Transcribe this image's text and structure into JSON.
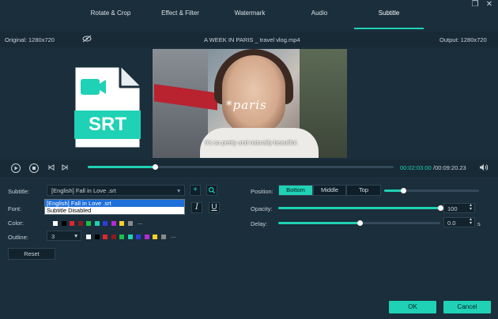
{
  "tabs": [
    {
      "label": "Rotate & Crop"
    },
    {
      "label": "Effect & Filter"
    },
    {
      "label": "Watermark"
    },
    {
      "label": "Audio"
    },
    {
      "label": "Subtitle"
    }
  ],
  "info": {
    "original": "Original: 1280x720",
    "filename": "A WEEK IN PARIS _ travel vlog.mp4",
    "output": "Output: 1280x720"
  },
  "preview": {
    "overlay_text": "*paris",
    "subtitle_text": "It's so pretty and naturally beautiful.",
    "srt_label": "SRT"
  },
  "playback": {
    "current_time": "00:02:03.00",
    "total_time": "/00:09:20.23",
    "progress": 0.22
  },
  "subtitle_settings": {
    "subtitle_label": "Subtitle:",
    "subtitle_value": "[English] Fall in Love .srt",
    "dropdown_options": [
      "[English] Fall in Love .srt",
      "Subtitle Disabled"
    ],
    "font_label": "Font:",
    "italic_label": "I",
    "underline_label": "U",
    "color_label": "Color:",
    "outline_label": "Outline:",
    "outline_value": "3",
    "more_label": "...",
    "reset_label": "Reset",
    "colors": [
      "#ffffff",
      "#000000",
      "#e0262c",
      "#8b1a1a",
      "#1fbf4d",
      "#1fd1b5",
      "#2a3fd8",
      "#b52ad8",
      "#f0d22a",
      "#8a8a8a"
    ]
  },
  "position_settings": {
    "position_label": "Position:",
    "options": [
      "Bottom",
      "Middle",
      "Top"
    ],
    "selected": "Bottom",
    "position_level": 0.2,
    "opacity_label": "Opacity:",
    "opacity_value": "100",
    "opacity_level": 1.0,
    "delay_label": "Delay:",
    "delay_value": "0.0",
    "delay_unit": "s",
    "delay_level": 0.5
  },
  "footer": {
    "ok_label": "OK",
    "cancel_label": "Cancel"
  },
  "accent_color": "#1fd1b5"
}
